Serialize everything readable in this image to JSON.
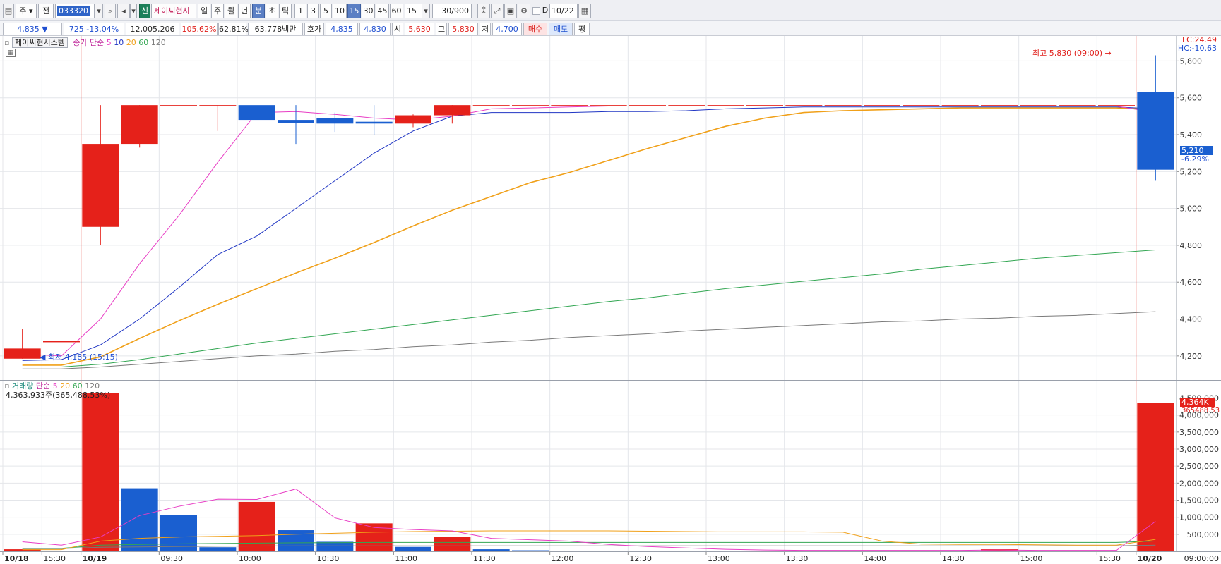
{
  "toolbar": {
    "mode_1": "주",
    "mode_2": "전",
    "code": "033320",
    "badge": "신",
    "stock_name": "제이씨현시",
    "period_buttons": [
      "일",
      "주",
      "월",
      "년",
      "분",
      "초",
      "틱"
    ],
    "interval_buttons": [
      "1",
      "3",
      "5",
      "10",
      "15",
      "30",
      "45",
      "60"
    ],
    "interval_value": "15",
    "count_value": "30",
    "count_total": "/900",
    "date_value": "10/22"
  },
  "quote": {
    "price": "4,835",
    "change_arrow": "▼",
    "change": "725",
    "change_rate": "-13.04%",
    "volume": "12,005,206",
    "volume_ratio": "105.62%",
    "turnover_ratio": "62.81%",
    "amount": "63,778백만",
    "ask_label": "호가",
    "bid": "4,835",
    "ask": "4,830",
    "open_label": "시",
    "open": "5,630",
    "high_label": "고",
    "high": "5,830",
    "low_label": "저",
    "low": "4,700",
    "buy_label": "매수",
    "sell_label": "매도",
    "eval_label": "평"
  },
  "price_pane": {
    "name_box": "제이씨현시스템",
    "ma_label": "종가 단순",
    "ma_periods": [
      "5",
      "10",
      "20",
      "60",
      "120"
    ],
    "lc_label": "LC:24.49",
    "hc_label": "HC:-10.63",
    "current_tag": "5,210",
    "current_rate": "-6.29%",
    "high_annotation": "최고 5,830 (09:00)",
    "low_annotation": "최저 4,185 (15:15)"
  },
  "volume_pane": {
    "label": "거래량",
    "ma_label": "단순",
    "ma_periods": [
      "5",
      "20",
      "60",
      "120"
    ],
    "info": "4,363,933주(365,488.53%)",
    "current_tag": "4,364K",
    "current_sub": "365488.53"
  },
  "colors": {
    "up": "#e5211a",
    "down": "#1a5fd0",
    "ma5": "#e83ec5",
    "ma10": "#2036c4",
    "ma20": "#f0a019",
    "ma60": "#32a652",
    "ma120": "#7a7a7a",
    "vol_label": "#1e8c7d"
  },
  "chart_data": [
    {
      "type": "candlestick",
      "title": "",
      "x": [
        "10/18 15:15",
        "10/18 15:30",
        "10/19 09:00",
        "10/19 09:15",
        "10/19 09:30",
        "10/19 09:45",
        "10/19 10:00",
        "10/19 10:15",
        "10/19 10:30",
        "10/19 10:45",
        "10/19 11:00",
        "10/19 11:15",
        "10/19 11:30",
        "10/19 11:45",
        "10/19 12:00",
        "10/19 12:15",
        "10/19 12:30",
        "10/19 12:45",
        "10/19 13:00",
        "10/19 13:15",
        "10/19 13:30",
        "10/19 13:45",
        "10/19 14:00",
        "10/19 14:15",
        "10/19 14:30",
        "10/19 14:45",
        "10/19 15:00",
        "10/19 15:15",
        "10/19 15:30",
        "10/20 09:00"
      ],
      "open": [
        4185,
        4280,
        4900,
        5350,
        5560,
        5560,
        5560,
        5480,
        5490,
        5470,
        5460,
        5505,
        5560,
        5560,
        5560,
        5560,
        5560,
        5560,
        5560,
        5560,
        5560,
        5560,
        5560,
        5560,
        5560,
        5560,
        5560,
        5560,
        5560,
        5630
      ],
      "high": [
        4345,
        4280,
        5560,
        5560,
        5560,
        5560,
        5560,
        5560,
        5520,
        5560,
        5510,
        5560,
        5560,
        5560,
        5560,
        5560,
        5560,
        5560,
        5560,
        5560,
        5560,
        5560,
        5560,
        5560,
        5560,
        5560,
        5560,
        5560,
        5560,
        5830
      ],
      "low": [
        4185,
        4280,
        4800,
        5330,
        5560,
        5420,
        5560,
        5350,
        5415,
        5400,
        5440,
        5460,
        5560,
        5560,
        5560,
        5560,
        5560,
        5560,
        5560,
        5560,
        5560,
        5560,
        5560,
        5560,
        5560,
        5560,
        5560,
        5560,
        5560,
        5150
      ],
      "close": [
        4240,
        4280,
        5350,
        5560,
        5560,
        5560,
        5480,
        5465,
        5460,
        5460,
        5505,
        5560,
        5560,
        5560,
        5560,
        5560,
        5560,
        5560,
        5560,
        5560,
        5560,
        5560,
        5560,
        5560,
        5560,
        5560,
        5560,
        5560,
        5560,
        5210
      ],
      "ma5": [
        4210,
        4200,
        4400,
        4700,
        4960,
        5250,
        5520,
        5525,
        5510,
        5490,
        5480,
        5500,
        5540,
        5545,
        5550,
        5555,
        5555,
        5555,
        5555,
        5555,
        5555,
        5555,
        5555,
        5555,
        5555,
        5555,
        5555,
        5555,
        5555,
        5520
      ],
      "ma10": [
        4175,
        4180,
        4260,
        4400,
        4570,
        4750,
        4850,
        5000,
        5150,
        5300,
        5420,
        5500,
        5520,
        5520,
        5520,
        5525,
        5525,
        5530,
        5540,
        5545,
        5550,
        5550,
        5550,
        5550,
        5550,
        5550,
        5550,
        5550,
        5550,
        5540
      ],
      "ma20": [
        4150,
        4150,
        4195,
        4295,
        4390,
        4480,
        4565,
        4650,
        4730,
        4815,
        4905,
        4990,
        5065,
        5140,
        5195,
        5260,
        5325,
        5385,
        5445,
        5490,
        5520,
        5530,
        5535,
        5540,
        5545,
        5545,
        5545,
        5545,
        5545,
        5535
      ],
      "ma60": [
        4140,
        4140,
        4155,
        4180,
        4210,
        4240,
        4270,
        4295,
        4320,
        4345,
        4370,
        4395,
        4420,
        4445,
        4470,
        4495,
        4515,
        4540,
        4565,
        4585,
        4605,
        4625,
        4645,
        4670,
        4690,
        4710,
        4730,
        4745,
        4760,
        4775
      ],
      "ma120": [
        4130,
        4130,
        4140,
        4155,
        4170,
        4185,
        4200,
        4210,
        4225,
        4235,
        4250,
        4260,
        4275,
        4285,
        4300,
        4310,
        4320,
        4335,
        4345,
        4355,
        4365,
        4375,
        4385,
        4390,
        4400,
        4405,
        4415,
        4420,
        4430,
        4440
      ],
      "ylim": [
        4100,
        5920
      ],
      "y_ticks": [
        "4,200",
        "4,400",
        "4,600",
        "4,800",
        "5,000",
        "5,200",
        "5,400",
        "5,600",
        "5,800"
      ],
      "x_ticks": [
        "10/18",
        "15:30",
        "10/19",
        "09:30",
        "10:00",
        "10:30",
        "11:00",
        "11:30",
        "12:00",
        "12:30",
        "13:00",
        "13:30",
        "14:00",
        "14:30",
        "15:00",
        "15:30",
        "10/20",
        "09:00:00"
      ],
      "grid": true
    },
    {
      "type": "bar",
      "title": "",
      "values": [
        60000,
        10000,
        4640000,
        1850000,
        1060000,
        120000,
        1450000,
        620000,
        280000,
        820000,
        130000,
        430000,
        60000,
        30000,
        20000,
        15000,
        10000,
        10000,
        10000,
        10000,
        10000,
        10000,
        10000,
        10000,
        10000,
        60000,
        10000,
        10000,
        10000,
        4363933
      ],
      "up": [
        true,
        true,
        true,
        false,
        false,
        false,
        true,
        false,
        false,
        true,
        false,
        true,
        false,
        false,
        false,
        false,
        false,
        false,
        false,
        false,
        false,
        false,
        false,
        false,
        false,
        true,
        false,
        false,
        false,
        true
      ],
      "ma5": [
        280000,
        180000,
        420000,
        1050000,
        1320000,
        1530000,
        1520000,
        1830000,
        980000,
        700000,
        640000,
        600000,
        380000,
        340000,
        300000,
        200000,
        140000,
        100000,
        60000,
        40000,
        30000,
        30000,
        30000,
        30000,
        30000,
        40000,
        30000,
        30000,
        30000,
        880000
      ],
      "ma20": [
        50000,
        50000,
        300000,
        380000,
        420000,
        440000,
        460000,
        500000,
        530000,
        560000,
        580000,
        590000,
        600000,
        600000,
        600000,
        600000,
        590000,
        580000,
        570000,
        570000,
        570000,
        560000,
        300000,
        210000,
        200000,
        200000,
        190000,
        180000,
        180000,
        350000
      ],
      "ma60": [
        90000,
        90000,
        180000,
        200000,
        220000,
        230000,
        240000,
        250000,
        255000,
        260000,
        260000,
        260000,
        260000,
        260000,
        260000,
        260000,
        260000,
        260000,
        260000,
        260000,
        260000,
        260000,
        260000,
        260000,
        260000,
        260000,
        260000,
        260000,
        260000,
        300000
      ],
      "ma120": [
        80000,
        80000,
        120000,
        130000,
        140000,
        150000,
        155000,
        160000,
        160000,
        160000,
        160000,
        160000,
        160000,
        160000,
        160000,
        160000,
        160000,
        160000,
        160000,
        160000,
        160000,
        160000,
        160000,
        160000,
        160000,
        160000,
        160000,
        160000,
        160000,
        180000
      ],
      "ylim": [
        0,
        4800000
      ],
      "y_ticks": [
        "500,000",
        "1,000,000",
        "1,500,000",
        "2,000,000",
        "2,500,000",
        "3,000,000",
        "3,500,000",
        "4,000,000",
        "4,500,000"
      ],
      "grid": true
    }
  ]
}
